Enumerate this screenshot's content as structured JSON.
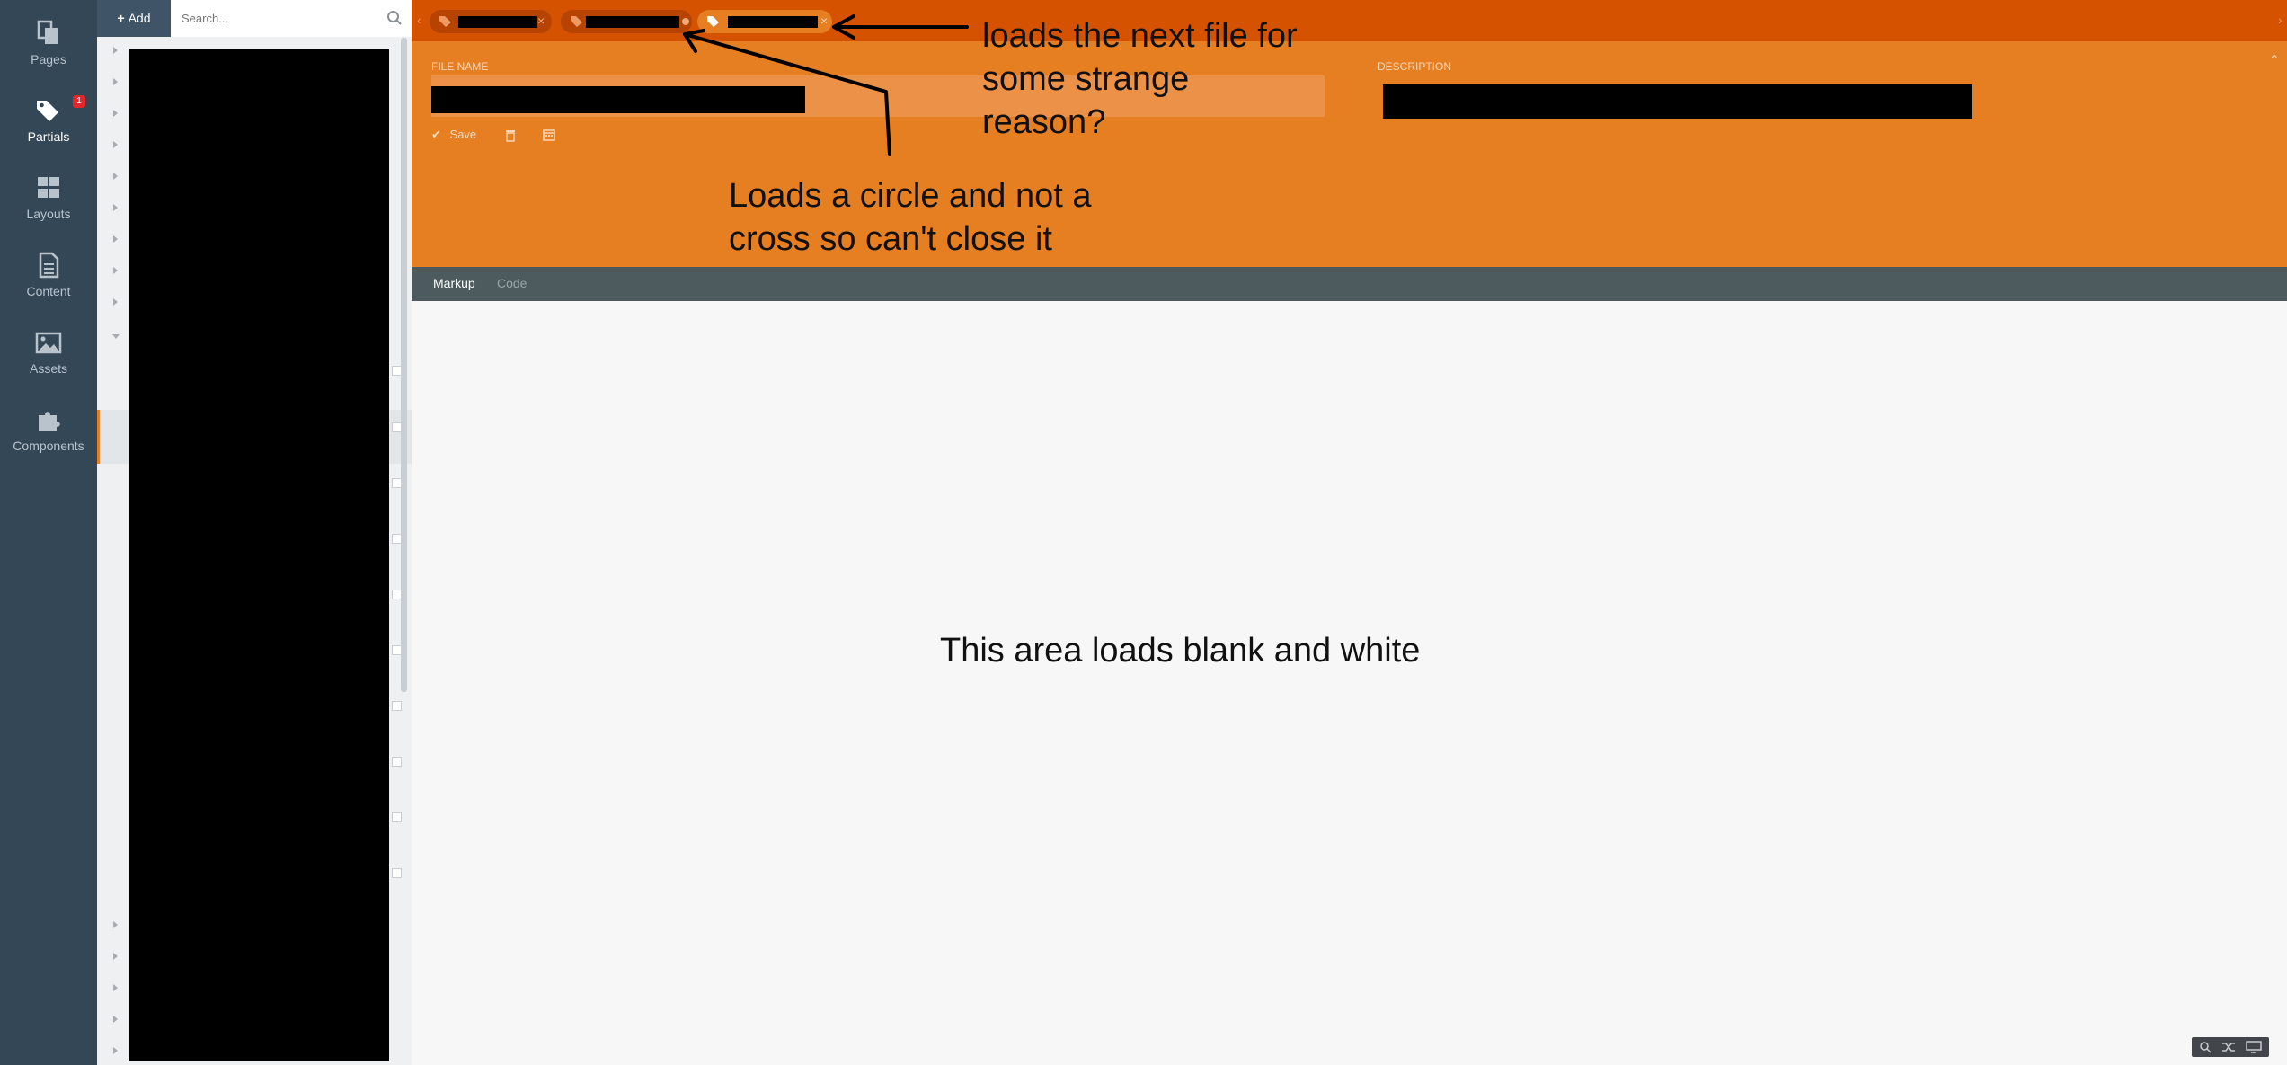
{
  "rail": {
    "items": [
      {
        "label": "Pages",
        "icon": "pages-icon"
      },
      {
        "label": "Partials",
        "icon": "tag-icon",
        "badge": "1"
      },
      {
        "label": "Layouts",
        "icon": "layouts-icon"
      },
      {
        "label": "Content",
        "icon": "content-icon"
      },
      {
        "label": "Assets",
        "icon": "assets-icon"
      },
      {
        "label": "Components",
        "icon": "components-icon"
      }
    ]
  },
  "side": {
    "add_label": "Add",
    "search_placeholder": "Search..."
  },
  "tabs": {
    "nav_left": "‹",
    "nav_right": "›",
    "close_glyph": "×"
  },
  "form": {
    "file_name_label": "FILE NAME",
    "description_label": "DESCRIPTION",
    "save_label": "Save",
    "collapse_glyph": "⌃"
  },
  "editor": {
    "tabs": [
      {
        "label": "Markup",
        "active": true
      },
      {
        "label": "Code",
        "active": false
      }
    ]
  },
  "annotations": {
    "next_file": "loads the next file for some strange reason?",
    "circle": "Loads a circle and not a cross so can't close it",
    "blank": "This area loads blank and white"
  },
  "colors": {
    "accent": "#e67e22",
    "tab_bar": "#d45200",
    "rail": "#344757",
    "badge": "#e3262c"
  }
}
